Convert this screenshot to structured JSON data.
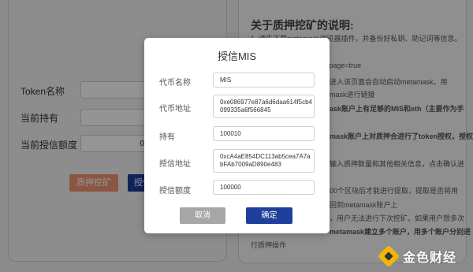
{
  "form": {
    "token_label": "Token名称",
    "holding_label": "当前持有",
    "allowance_label": "当前授信额度",
    "allowance_value": "0",
    "pledge_button": "质押挖矿",
    "auth_button": "授信"
  },
  "instructions": {
    "title": "关于质押挖矿的说明:",
    "lines": [
      "1. 请先下载metamask浏览器插件，并备份好私钥、助记词等信息。",
      "p/1122854?from_voters_page=true",
      "进入该页面会自动启动metamask。用",
      "mask进行链接",
      "ask账户上有足够的MIS和eth（主要作为手",
      "mask账户上对质押合进行了token授权，授权",
      "输入质押数量和其他相关信息，点击确认进",
      "00个区块后才能进行提取，提取是否将用",
      "回到metamask账户上",
      "，用户无法进行下次挖矿。如果用户想多次",
      "metamask建立多个账户，用多个账户分别进",
      "行质押操作"
    ]
  },
  "dialog": {
    "title": "授信MIS",
    "token_label": "代币名称",
    "token_value": "MIS",
    "token_address_label": "代币地址",
    "token_address_value": "0xe086977e87a6d6daa614f5cb4099335a6f566845",
    "holding_label": "持有",
    "holding_value": "100010",
    "auth_address_label": "授信地址",
    "auth_address_value": "0xcA4aE854DC113ab5cea7A7abFAb7009aD890e483",
    "amount_label": "授信额度",
    "amount_value": "100000",
    "cancel_label": "取消",
    "confirm_label": "确定"
  },
  "watermark": {
    "text": "金色财经"
  },
  "colors": {
    "primary": "#1e3f9c",
    "pledge": "#ef9674",
    "cancel": "#a6a6a6",
    "logo": "#f2b705"
  }
}
